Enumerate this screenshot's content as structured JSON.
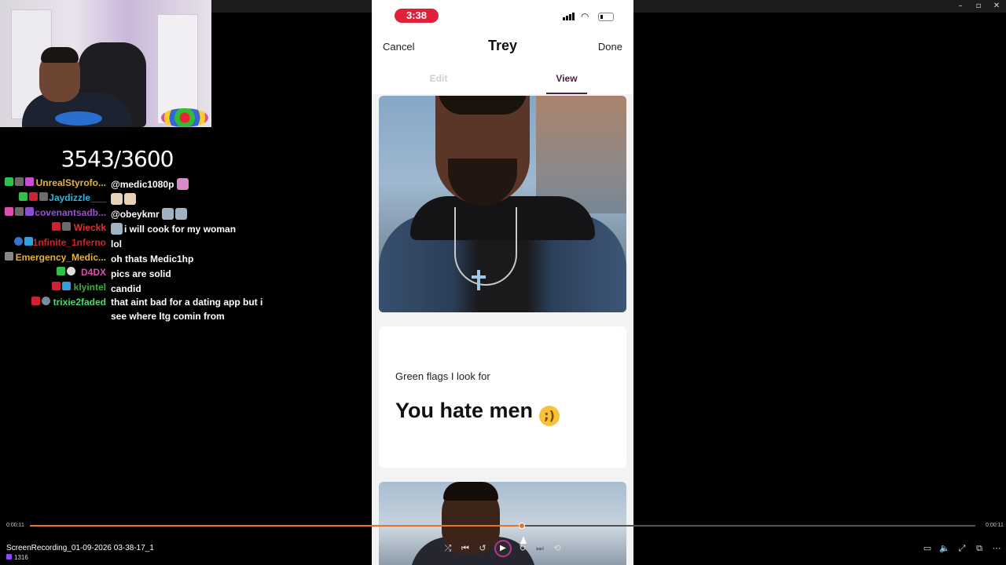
{
  "window": {
    "minimize_icon": "minimize-icon",
    "restore_icon": "restore-icon",
    "close_icon": "close-icon"
  },
  "overlay": {
    "counter": "3543/3600"
  },
  "chat": [
    {
      "user": "UnrealStyrofo...",
      "color": "#e8b43a",
      "text": "@medic1080p"
    },
    {
      "user": "Jaydizzle___",
      "color": "#2fb5e0",
      "text": ""
    },
    {
      "user": "covenantsadb...",
      "color": "#9d4fd6",
      "text": "@obeykmr"
    },
    {
      "user": "Wieckk",
      "color": "#e0322c",
      "text": "i will cook for my woman"
    },
    {
      "user": "1nfinite_1nferno",
      "color": "#d02525",
      "text": "lol"
    },
    {
      "user": "Emergency_Medic...",
      "color": "#e8b43a",
      "text": "oh thats Medic1hp"
    },
    {
      "user": "D4DX",
      "color": "#e04fb0",
      "text": "pics are solid"
    },
    {
      "user": "klyintel",
      "color": "#3cae3c",
      "text": "candid"
    },
    {
      "user": "trixie2faded",
      "color": "#3de06a",
      "text": "that aint bad for a dating app but i see where ltg comin from"
    }
  ],
  "phone": {
    "time": "3:38",
    "header": {
      "cancel": "Cancel",
      "title": "Trey",
      "done": "Done"
    },
    "tabs": {
      "edit": "Edit",
      "view": "View"
    },
    "prompt": {
      "question": "Green flags I look for",
      "answer": "You hate men"
    }
  },
  "player": {
    "time_elapsed": "0:00:11",
    "time_total": "0:00:11",
    "progress_fraction": 0.52,
    "filename": "ScreenRecording_01-09-2026 03-38-17_1",
    "views": "1316",
    "accent_color": "#e8722a"
  }
}
